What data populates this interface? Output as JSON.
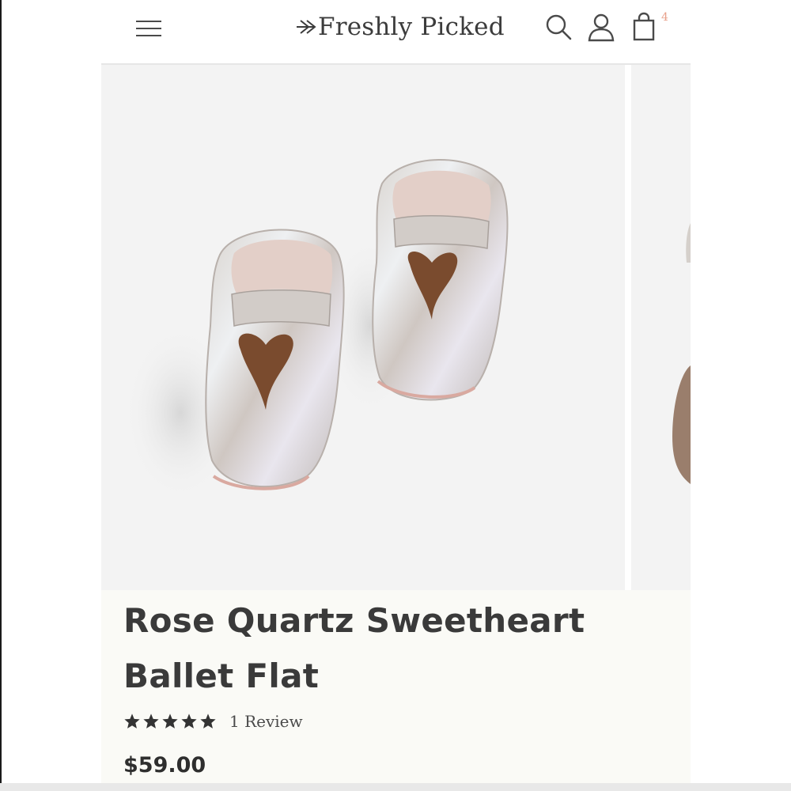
{
  "header": {
    "brand": "Freshly Picked",
    "cart_count": "4",
    "icons": [
      "menu-icon",
      "search-icon",
      "account-icon",
      "cart-icon"
    ]
  },
  "product": {
    "title": "Rose Quartz Sweetheart Ballet Flat",
    "rating": 5,
    "rating_max": 5,
    "review_text": "1 Review",
    "price": "$59.00"
  },
  "colors": {
    "cart_badge": "#e8a08a",
    "text_dark": "#3a3a3a",
    "image_bg": "#f3f3f3"
  }
}
